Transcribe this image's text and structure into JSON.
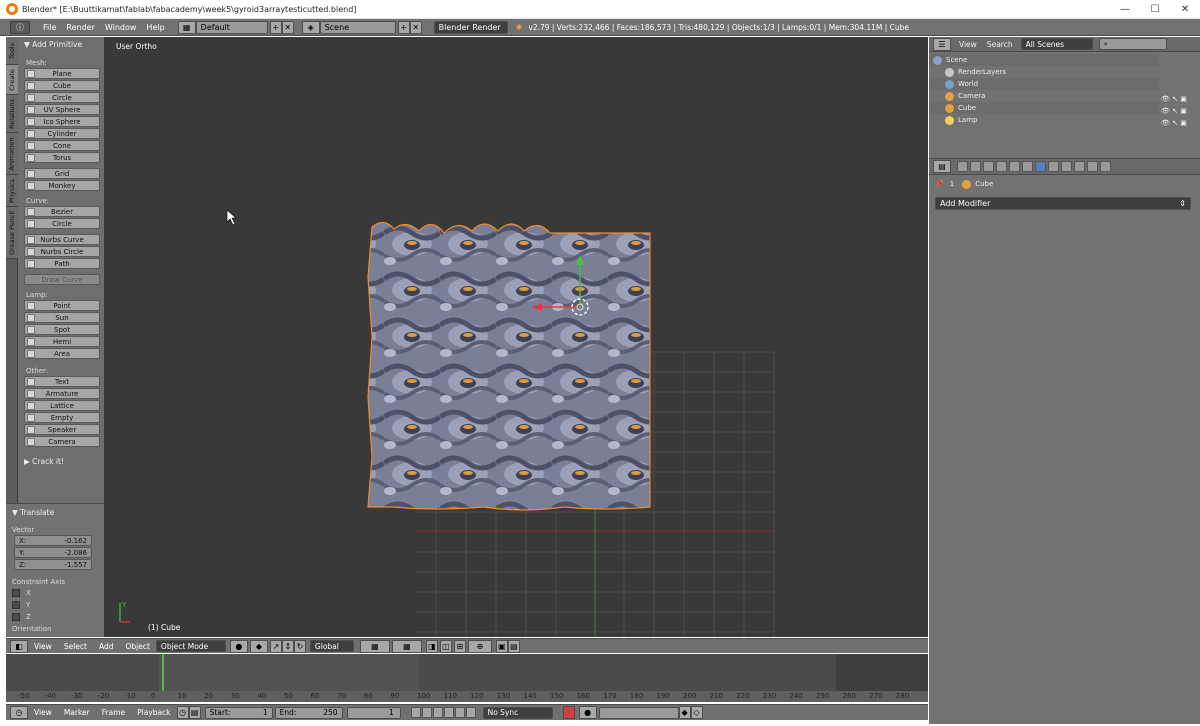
{
  "window": {
    "title": "Blender* [E:\\Buuttikamat\\fablab\\fabacademy\\week5\\gyroid3arraytesticutted.blend]",
    "controls": [
      "—",
      "☐",
      "✕"
    ]
  },
  "info_header": {
    "menus": [
      "File",
      "Render",
      "Window",
      "Help"
    ],
    "screen_layout": "Default",
    "scene": "Scene",
    "render_engine": "Blender Render",
    "stats": "v2.79 | Verts:232,466 | Faces:186,573 | Tris:480,129 | Objects:1/3 | Lamps:0/1 | Mem:304.11M | Cube"
  },
  "tool_tabs": [
    "Tools",
    "Create",
    "Relations",
    "Animation",
    "Physics",
    "Grease Pencil"
  ],
  "tool_shelf": {
    "panel_title": "▼ Add Primitive",
    "mesh_label": "Mesh:",
    "mesh": [
      "Plane",
      "Cube",
      "Circle",
      "UV Sphere",
      "Ico Sphere",
      "Cylinder",
      "Cone",
      "Torus"
    ],
    "mesh2": [
      "Grid",
      "Monkey"
    ],
    "curve_label": "Curve:",
    "curve": [
      "Bezier",
      "Circle"
    ],
    "curve2": [
      "Nurbs Curve",
      "Nurbs Circle",
      "Path"
    ],
    "draw_curve": "Draw Curve",
    "lamp_label": "Lamp:",
    "lamp": [
      "Point",
      "Sun",
      "Spot",
      "Hemi",
      "Area"
    ],
    "other_label": "Other:",
    "other": [
      "Text",
      "Armature",
      "Lattice",
      "Empty",
      "Speaker",
      "Camera"
    ],
    "crackit": "▶ Crack it!"
  },
  "operator": {
    "title": "▼ Translate",
    "vector_label": "Vector",
    "x_label": "X:",
    "x": "-0.162",
    "y_label": "Y:",
    "y": "-2.086",
    "z_label": "Z:",
    "z": "-1.557",
    "constraint_label": "Constraint Axis",
    "axes": [
      "X",
      "Y",
      "Z"
    ],
    "orientation_label": "Orientation"
  },
  "viewport": {
    "view_label": "User Ortho",
    "object_label": "(1) Cube"
  },
  "outliner": {
    "view": "View",
    "search": "Search",
    "filter": "All Scenes",
    "rows": [
      "Scene",
      "RenderLayers",
      "World",
      "Camera",
      "Cube",
      "Lamp"
    ]
  },
  "properties": {
    "object_name": "Cube",
    "users": "1",
    "add_modifier": "Add Modifier"
  },
  "header3d": {
    "menus": [
      "View",
      "Select",
      "Add",
      "Object"
    ],
    "mode": "Object Mode",
    "orientation": "Global"
  },
  "timeline": {
    "ticks": [
      "-50",
      "-40",
      "-30",
      "-20",
      "-10",
      "0",
      "10",
      "20",
      "30",
      "40",
      "50",
      "60",
      "70",
      "80",
      "90",
      "100",
      "110",
      "120",
      "130",
      "140",
      "150",
      "160",
      "170",
      "180",
      "190",
      "200",
      "210",
      "220",
      "230",
      "240",
      "250",
      "260",
      "270",
      "280"
    ],
    "menus": [
      "View",
      "Marker",
      "Frame",
      "Playback"
    ],
    "start_label": "Start:",
    "start": "1",
    "end_label": "End:",
    "end": "250",
    "current": "1",
    "sync": "No Sync"
  },
  "colors": {
    "selection_outline": "#f08b2a",
    "x_axis": "#e33b3b",
    "y_axis": "#4bbf3b",
    "active_icon": "#5680c2"
  }
}
